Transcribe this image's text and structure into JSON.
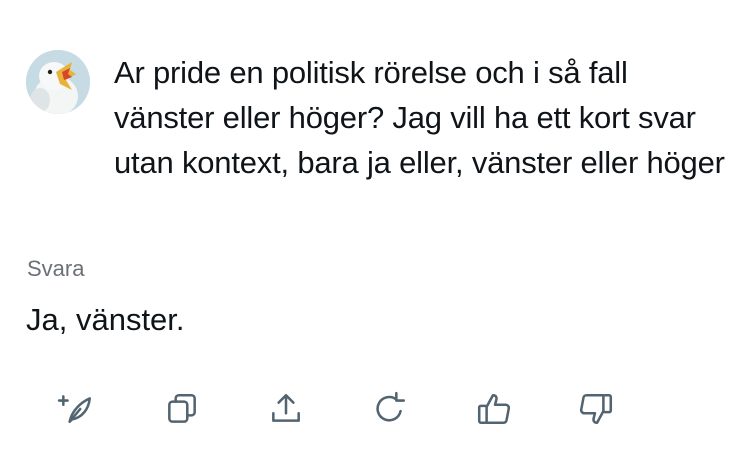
{
  "prompt": {
    "text": "Ar pride en politisk rörelse och i så fall vänster eller höger? Jag vill ha ett kort svar utan kontext, bara ja eller, vänster eller höger"
  },
  "response": {
    "label": "Svara",
    "text": "Ja, vänster."
  },
  "actions": [
    {
      "icon": "new-chat-quill-icon"
    },
    {
      "icon": "copy-icon"
    },
    {
      "icon": "share-icon"
    },
    {
      "icon": "regenerate-icon"
    },
    {
      "icon": "thumbs-up-icon"
    },
    {
      "icon": "thumbs-down-icon"
    }
  ],
  "colors": {
    "text": "#0f1419",
    "muted": "#6b7079",
    "icon": "#536471",
    "background": "#ffffff"
  }
}
